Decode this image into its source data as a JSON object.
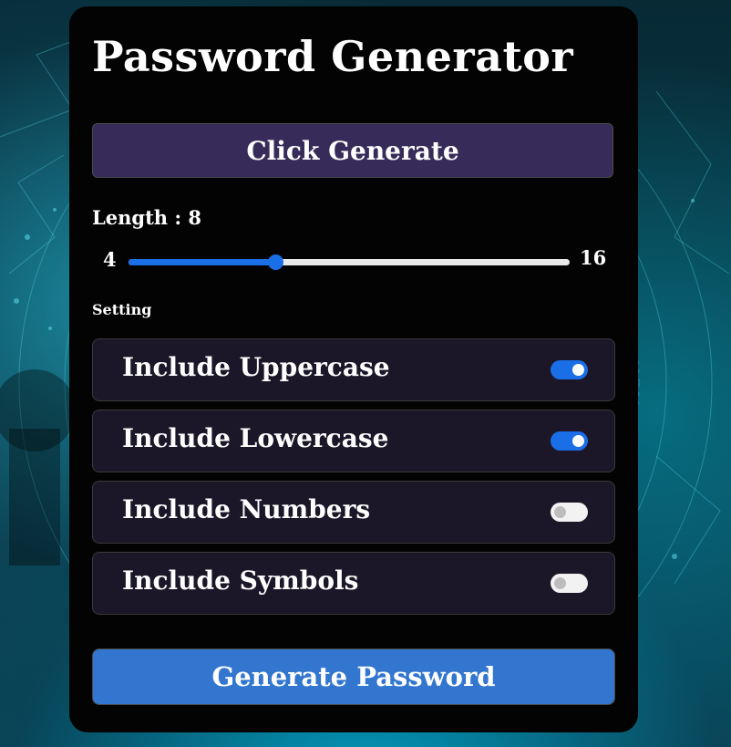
{
  "app": {
    "title": "Password Generator",
    "result_button_label": "Click Generate"
  },
  "length": {
    "label": "Length : 8",
    "value": 8,
    "min_label": "4",
    "max_label": "16",
    "min": 4,
    "max": 16
  },
  "settings": {
    "section_label": "Setting",
    "options": [
      {
        "label": "Include Uppercase",
        "enabled": true
      },
      {
        "label": "Include Lowercase",
        "enabled": true
      },
      {
        "label": "Include Numbers",
        "enabled": false
      },
      {
        "label": "Include Symbols",
        "enabled": false
      }
    ]
  },
  "generate_button_label": "Generate Password",
  "colors": {
    "accent": "#1b6fe6",
    "generate_button": "#3276cf",
    "result_button": "#372c59",
    "card": "#030303",
    "option_bg": "#1b1728"
  }
}
